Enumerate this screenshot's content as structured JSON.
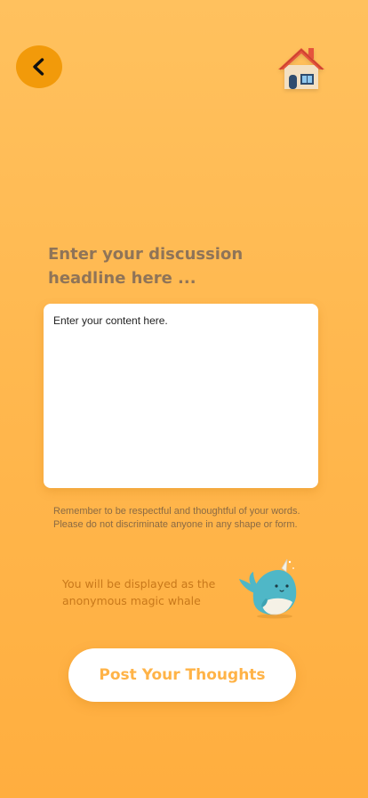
{
  "header": {
    "back_icon": "chevron-left-icon",
    "home_icon": "house-icon"
  },
  "form": {
    "headline_placeholder": "Enter your discussion headline here ...",
    "content_placeholder": "Enter your content here.",
    "notice_line1": "Remember to be respectful and thoughtful of your words.",
    "notice_line2": "Please do not discriminate anyone in any shape or form."
  },
  "identity": {
    "line1": "You will be displayed as the",
    "line2": "anonymous magic whale",
    "avatar_icon": "narwhal-icon"
  },
  "actions": {
    "post_label": "Post Your Thoughts"
  },
  "colors": {
    "background_top": "#FFC15E",
    "background_bottom": "#FFAE3F",
    "back_button": "#F29A0A",
    "accent_text": "#FFB347",
    "anon_text": "#C8781A"
  }
}
